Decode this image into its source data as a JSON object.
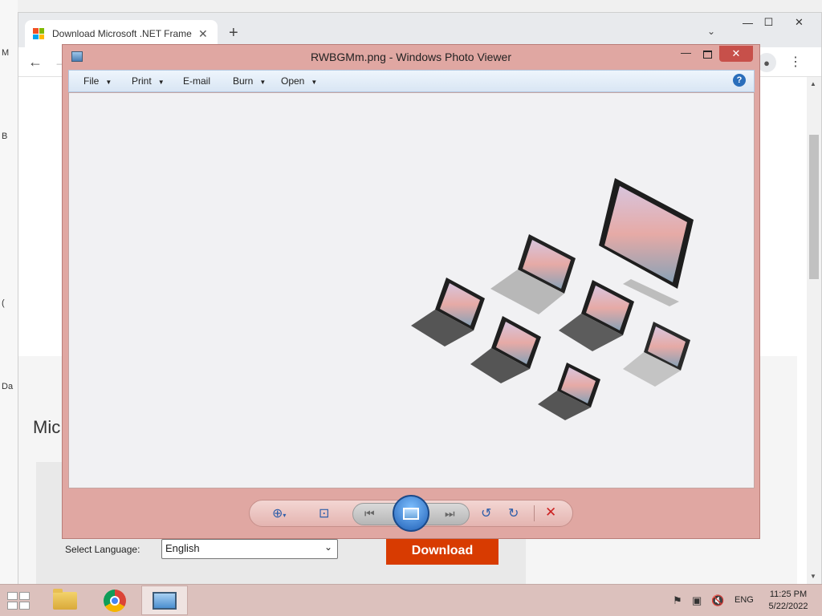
{
  "desktop": {
    "fragments": [
      "M",
      "B",
      "(",
      "Da"
    ]
  },
  "browser": {
    "tab_title": "Download Microsoft .NET Frame",
    "tab_close": "✕",
    "new_tab": "+",
    "tab_list": "⌄",
    "controls": {
      "minimize": "—",
      "maximize": "☐",
      "close": "✕"
    },
    "nav": {
      "back": "←",
      "forward": "→"
    },
    "avatar_icon": "person-icon",
    "menu_icon": "⋮",
    "page": {
      "heading_fragment": "Mic",
      "language_label": "Select Language:",
      "language_value": "English",
      "download_label": "Download"
    }
  },
  "photo_viewer": {
    "title": "RWBGMm.png - Windows Photo Viewer",
    "controls": {
      "minimize": "—",
      "close": "✕"
    },
    "menu": [
      {
        "label": "File",
        "has_dropdown": true
      },
      {
        "label": "Print",
        "has_dropdown": true
      },
      {
        "label": "E-mail",
        "has_dropdown": false
      },
      {
        "label": "Burn",
        "has_dropdown": true
      },
      {
        "label": "Open",
        "has_dropdown": true
      }
    ],
    "help": "?",
    "image_description_icon": "surface-devices-image",
    "toolbar": {
      "zoom_icon": "zoom-icon",
      "fit_icon": "actual-size-icon",
      "prev_icon": "previous-icon",
      "slideshow_icon": "slideshow-icon",
      "next_icon": "next-icon",
      "rotate_left_icon": "rotate-counterclockwise-icon",
      "rotate_right_icon": "rotate-clockwise-icon",
      "delete_icon": "delete-icon"
    }
  },
  "taskbar": {
    "apps": [
      "file-explorer",
      "google-chrome",
      "windows-photo-viewer"
    ],
    "active_app": "windows-photo-viewer",
    "language": "ENG",
    "time": "11:25 PM",
    "date": "5/22/2022"
  },
  "colors": {
    "viewer_frame": "#e0a7a2",
    "viewer_close": "#c7504a",
    "download_button": "#d83b01",
    "taskbar": "#dcc1bd"
  }
}
